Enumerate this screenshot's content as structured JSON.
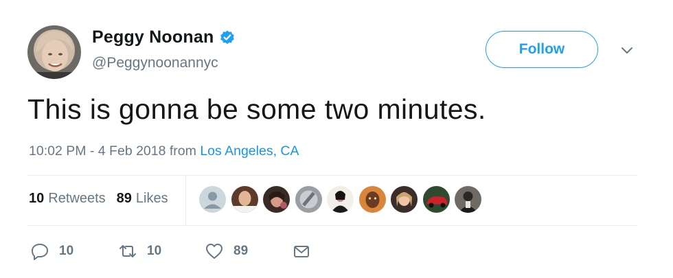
{
  "user": {
    "display_name": "Peggy Noonan",
    "handle": "@Peggynoonannyc",
    "verified": true
  },
  "follow_button": {
    "label": "Follow"
  },
  "tweet": {
    "text": "This is gonna be some two minutes.",
    "timestamp": "10:02 PM - 4 Feb 2018",
    "from_label": "from",
    "location": "Los Angeles, CA"
  },
  "stats": {
    "retweets_count": "10",
    "retweets_label": "Retweets",
    "likes_count": "89",
    "likes_label": "Likes"
  },
  "actions": {
    "reply_count": "10",
    "retweet_count": "10",
    "like_count": "89"
  },
  "liker_avatars": [
    "default-avatar",
    "avatar-1",
    "avatar-2",
    "avatar-3",
    "avatar-4",
    "avatar-5",
    "avatar-6",
    "avatar-7",
    "avatar-8"
  ],
  "colors": {
    "accent": "#1da1f2",
    "link": "#1b95e0",
    "muted": "#657786",
    "text": "#14171a",
    "divider": "#e6ecf0"
  },
  "icons": [
    "verified-badge-icon",
    "chevron-down-icon",
    "reply-icon",
    "retweet-icon",
    "heart-icon",
    "envelope-icon"
  ]
}
